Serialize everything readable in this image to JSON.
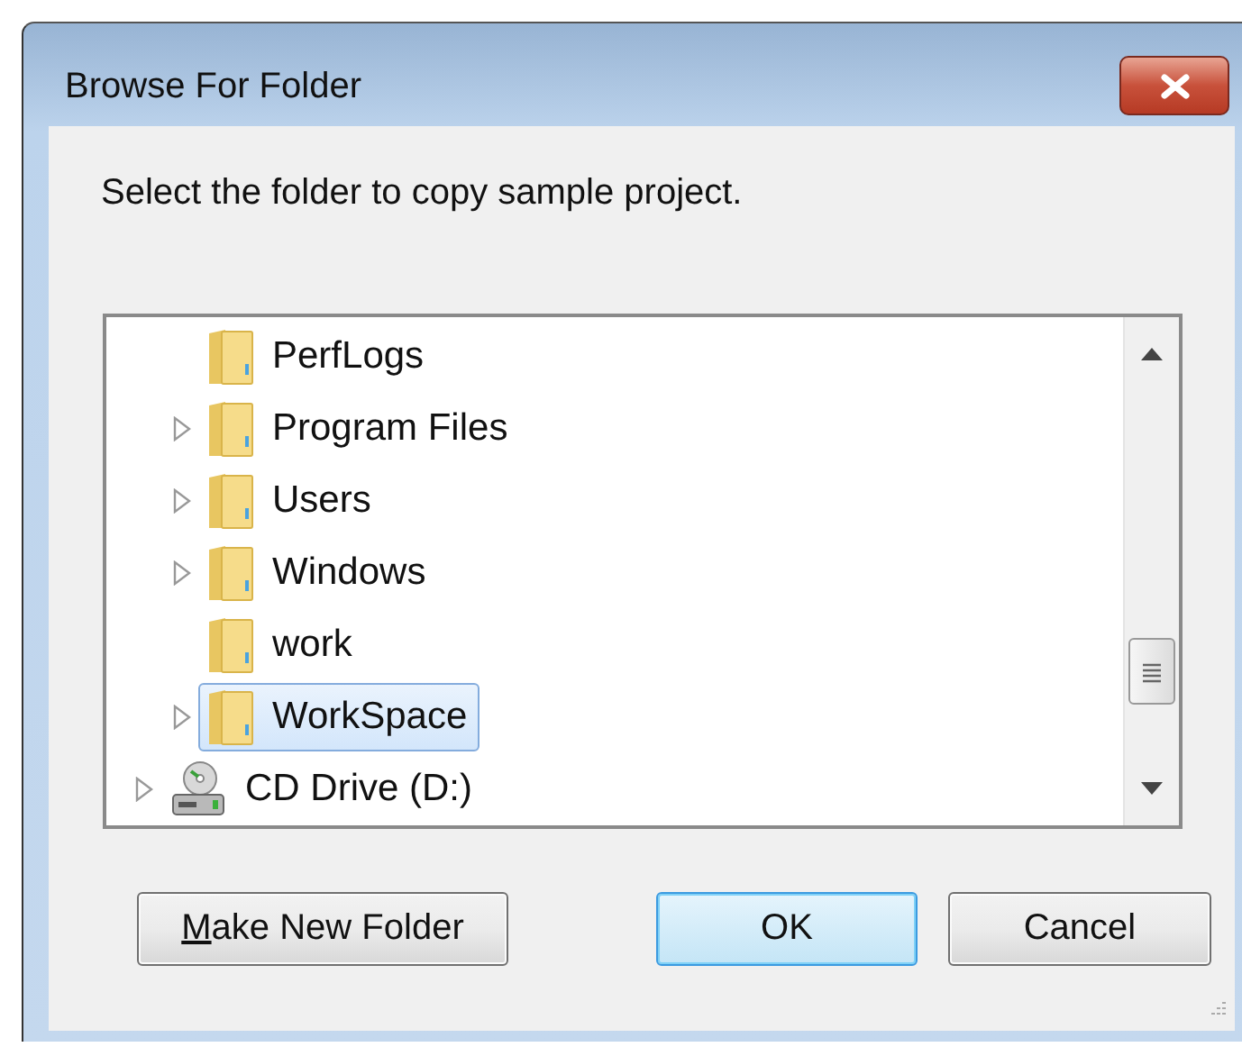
{
  "window": {
    "title": "Browse For Folder"
  },
  "instruction": "Select the folder to copy sample project.",
  "tree": {
    "items": [
      {
        "children": [
          {
            "label": "PerfLogs",
            "kind": "folder",
            "expandable": false,
            "selected": false
          },
          {
            "label": "Program Files",
            "kind": "folder",
            "expandable": true,
            "selected": false
          },
          {
            "label": "Users",
            "kind": "folder",
            "expandable": true,
            "selected": false
          },
          {
            "label": "Windows",
            "kind": "folder",
            "expandable": true,
            "selected": false
          },
          {
            "label": "work",
            "kind": "folder",
            "expandable": false,
            "selected": false
          },
          {
            "label": "WorkSpace",
            "kind": "folder",
            "expandable": true,
            "selected": true
          }
        ]
      },
      {
        "label": "CD Drive (D:)",
        "kind": "drive",
        "expandable": true,
        "selected": false
      }
    ]
  },
  "buttons": [
    {
      "label": "Make New Folder",
      "first_letter_underlined": true,
      "default": false
    },
    {
      "label": "OK",
      "default": true
    },
    {
      "label": "Cancel",
      "default": false
    }
  ]
}
